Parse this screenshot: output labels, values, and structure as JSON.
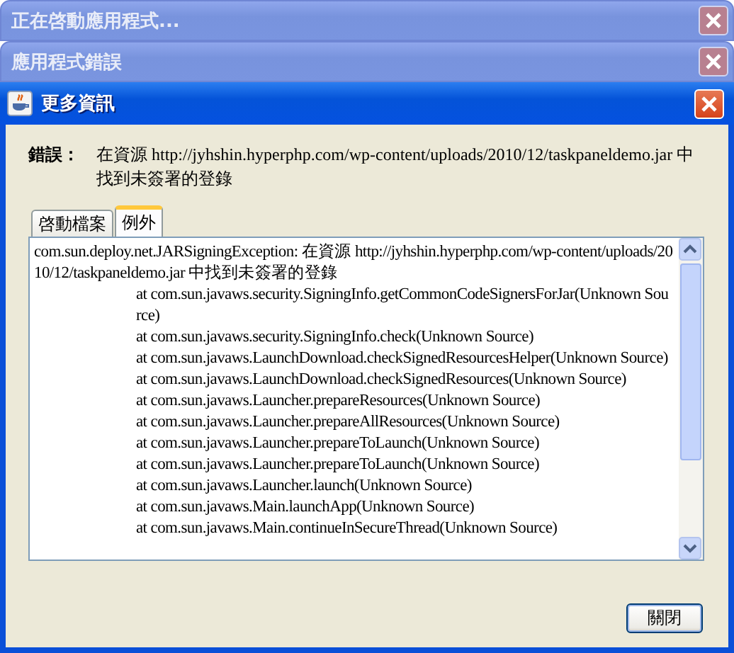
{
  "background_windows": [
    {
      "title": "正在啓動應用程式..."
    },
    {
      "title": "應用程式錯誤"
    }
  ],
  "window": {
    "title": "更多資訊"
  },
  "error": {
    "label": "錯誤：",
    "message": "在資源 http://jyhshin.hyperphp.com/wp-content/uploads/2010/12/taskpaneldemo.jar 中找到未簽署的登錄"
  },
  "tabs": [
    {
      "label": "啓動檔案",
      "selected": false
    },
    {
      "label": "例外",
      "selected": true
    }
  ],
  "exception_lines": [
    {
      "kind": "message",
      "text": "com.sun.deploy.net.JARSigningException: 在資源 http://jyhshin.hyperphp.com/wp-content/uploads/2010/12/taskpaneldemo.jar 中找到未簽署的登錄"
    },
    {
      "kind": "frame",
      "text": "at com.sun.javaws.security.SigningInfo.getCommonCodeSignersForJar(Unknown Source)"
    },
    {
      "kind": "frame",
      "text": "at com.sun.javaws.security.SigningInfo.check(Unknown Source)"
    },
    {
      "kind": "frame",
      "text": "at com.sun.javaws.LaunchDownload.checkSignedResourcesHelper(Unknown Source)"
    },
    {
      "kind": "frame",
      "text": "at com.sun.javaws.LaunchDownload.checkSignedResources(Unknown Source)"
    },
    {
      "kind": "frame",
      "text": "at com.sun.javaws.Launcher.prepareResources(Unknown Source)"
    },
    {
      "kind": "frame",
      "text": "at com.sun.javaws.Launcher.prepareAllResources(Unknown Source)"
    },
    {
      "kind": "frame",
      "text": "at com.sun.javaws.Launcher.prepareToLaunch(Unknown Source)"
    },
    {
      "kind": "frame",
      "text": "at com.sun.javaws.Launcher.prepareToLaunch(Unknown Source)"
    },
    {
      "kind": "frame",
      "text": "at com.sun.javaws.Launcher.launch(Unknown Source)"
    },
    {
      "kind": "frame",
      "text": "at com.sun.javaws.Main.launchApp(Unknown Source)"
    },
    {
      "kind": "frame",
      "text": "at com.sun.javaws.Main.continueInSecureThread(Unknown Source)"
    }
  ],
  "buttons": [
    {
      "label": "關閉"
    }
  ]
}
